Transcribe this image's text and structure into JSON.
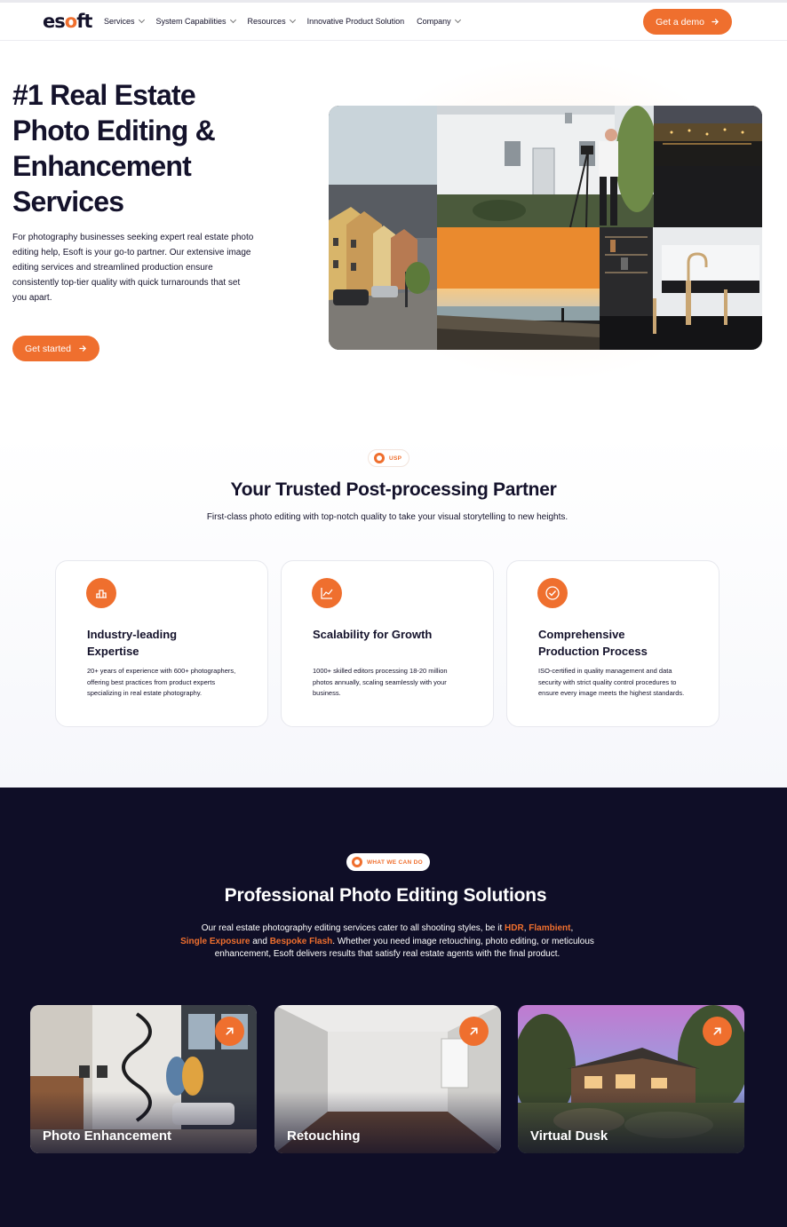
{
  "header": {
    "logo": {
      "left": "es",
      "o": "o",
      "right": "ft"
    },
    "nav": [
      {
        "label": "Services",
        "has_dropdown": true
      },
      {
        "label": "System Capabilities",
        "has_dropdown": true
      },
      {
        "label": "Resources",
        "has_dropdown": true
      },
      {
        "label": "Innovative Product Solution",
        "has_dropdown": false
      },
      {
        "label": "Company",
        "has_dropdown": true
      }
    ],
    "cta_label": "Get a demo",
    "cta_icon": "arrow-right-icon"
  },
  "hero": {
    "title": "#1 Real Estate Photo Editing & Enhancement Services",
    "description": "For photography businesses seeking expert real estate photo editing help, Esoft is your go-to partner. Our extensive image editing services and streamlined production ensure consistently top-tier quality with quick turnarounds that set you apart.",
    "cta_label": "Get started",
    "cta_icon": "arrow-right-icon"
  },
  "usp": {
    "badge": "USP",
    "title": "Your Trusted Post-processing Partner",
    "subtitle": "First-class photo editing with top-notch quality to take your visual storytelling to new heights.",
    "cards": [
      {
        "icon": "podium-icon",
        "title": "Industry-leading Expertise",
        "text": "20+ years of experience with 600+ photographers, offering best practices from product experts specializing in real estate photography."
      },
      {
        "icon": "chart-line-icon",
        "title": "Scalability for Growth",
        "text": "1000+ skilled editors processing 18-20 million photos annually, scaling seamlessly with your business."
      },
      {
        "icon": "check-circle-icon",
        "title": "Comprehensive Production Process",
        "text": "ISO-certified in quality management and data security with strict quality control procedures to ensure every image meets the highest standards."
      }
    ]
  },
  "solutions": {
    "badge": "WHAT WE CAN DO",
    "title": "Professional Photo Editing Solutions",
    "text_parts": {
      "p1": "Our real estate photography editing services cater to all shooting styles, be it ",
      "hdr": "HDR",
      "p2": ", ",
      "flambient": "Flambient",
      "p3": ",",
      "single": "Single Exposure",
      "p4": " and ",
      "bespoke": "Bespoke Flash",
      "p5": ". Whether you need image retouching, photo editing, or meticulous enhancement, Esoft delivers results that satisfy real estate agents with the final product."
    },
    "cards": [
      {
        "label": "Photo Enhancement",
        "icon": "arrow-up-right-icon"
      },
      {
        "label": "Retouching",
        "icon": "arrow-up-right-icon"
      },
      {
        "label": "Virtual Dusk",
        "icon": "arrow-up-right-icon"
      }
    ]
  },
  "colors": {
    "accent": "#ef6f2e",
    "text": "#14122b",
    "dark_bg": "#0f0e27"
  }
}
